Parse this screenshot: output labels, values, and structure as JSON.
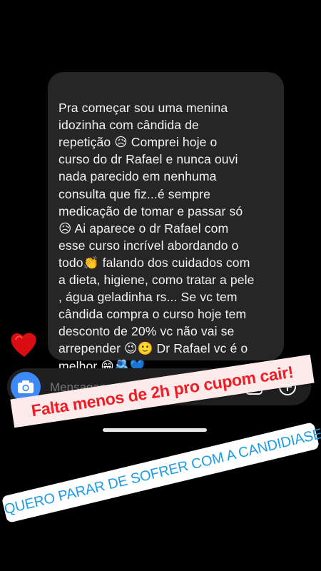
{
  "message": {
    "text": "Pra começar sou uma menina\nidozinha com cândida de\nrepetição 😥 Comprei hoje o\ncurso do dr Rafael e nunca ouvi\nnada parecido em nenhuma\nconsulta que fiz...é sempre\nmedicação de tomar e passar só\n😥 Ai aparece o dr Rafael  com\nesse curso incrível abordando o\ntodo👏 falando dos cuidados com\na dieta, higiene, como tratar a pele\n, água geladinha rs... Se vc tem\ncândida compra o curso hoje tem\ndesconto de 20% vc não vai se\narrepender 😉🙂 Dr Rafael vc é o\nmelhor 😁🫂💙"
  },
  "composer": {
    "placeholder": "Mensagem...",
    "camera_icon": "camera-icon",
    "mic_icon": "microphone-icon",
    "gallery_icon": "gallery-icon",
    "add_icon": "plus-circle-icon"
  },
  "stickers": {
    "promo_text": "Falta menos de 2h pro cupom cair!",
    "link_text": "QUERO PARAR DE SOFRER COM A CANDIDIASE",
    "link_icon": "link-icon",
    "heart_icon": "heart-sticker"
  },
  "colors": {
    "background": "#000000",
    "bubble": "#262626",
    "camera_button": "#3d8af7",
    "promo_text": "#f11c24",
    "promo_bg": "#fdebeb",
    "link_text": "#1e9be6"
  }
}
